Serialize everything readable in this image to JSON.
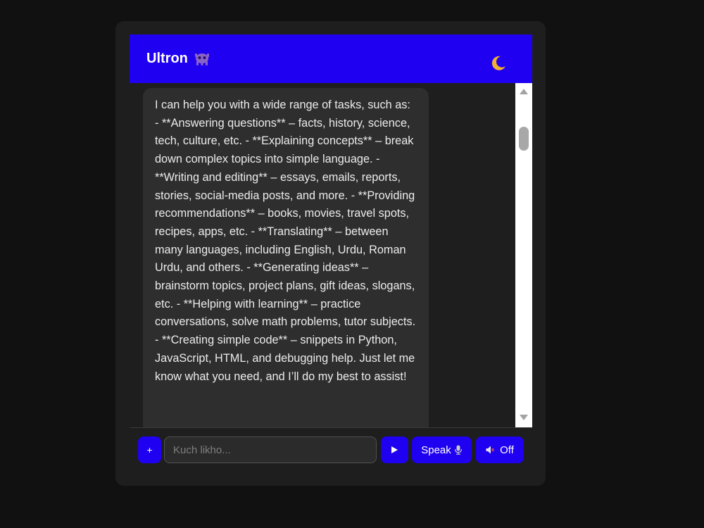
{
  "header": {
    "title": "Ultron",
    "title_icon": "alien-monster-icon",
    "theme_toggle_icon": "crescent-moon-icon"
  },
  "chat": {
    "messages": [
      {
        "role": "assistant",
        "text": "I can help you with a wide range of tasks, such as: - **Answering questions** – facts, history, science, tech, culture, etc. - **Explaining concepts** – break down complex topics into simple language. - **Writing and editing** – essays, emails, reports, stories, social-media posts, and more. - **Providing recommendations** – books, movies, travel spots, recipes, apps, etc. - **Translating** – between many languages, including English, Urdu, Roman Urdu, and others. - **Generating ideas** – brainstorm topics, project plans, gift ideas, slogans, etc. - **Helping with learning** – practice conversations, solve math problems, tutor subjects. - **Creating simple code** – snippets in Python, JavaScript, HTML, and debugging help. Just let me know what you need, and I’ll do my best to assist!"
      }
    ]
  },
  "input_bar": {
    "plus_label": "+",
    "placeholder": "Kuch likho...",
    "value": "",
    "send_icon": "play-triangle-icon",
    "speak_label": "Speak",
    "speak_icon": "microphone-icon",
    "mute_label": "Off",
    "mute_icon": "muted-speaker-icon"
  },
  "colors": {
    "accent": "#2000f0",
    "page_background": "#111111",
    "card_background": "#1e1e1e",
    "bubble_background": "#2e2e2e",
    "text": "#ececec"
  }
}
